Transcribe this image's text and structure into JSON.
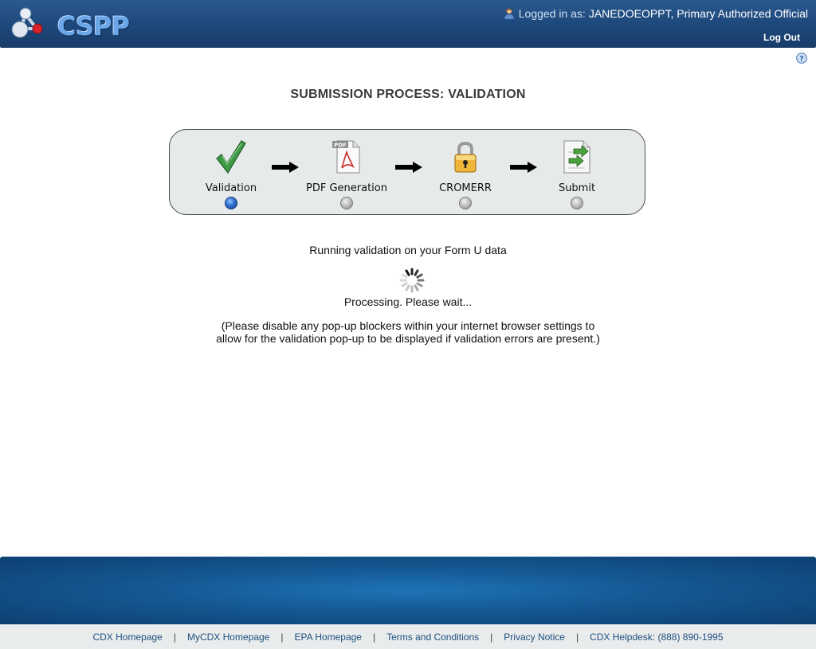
{
  "header": {
    "brand": "CSPP",
    "logged_in_prefix": "Logged in as:",
    "user": "JANEDOEOPPT, Primary Authorized Official",
    "logout": "Log Out"
  },
  "page": {
    "title": "SUBMISSION PROCESS: VALIDATION"
  },
  "process": {
    "steps": [
      {
        "label": "Validation",
        "icon": "checkmark-icon",
        "active": true
      },
      {
        "label": "PDF Generation",
        "icon": "pdf-document-icon",
        "active": false
      },
      {
        "label": "CROMERR",
        "icon": "padlock-icon",
        "active": false
      },
      {
        "label": "Submit",
        "icon": "submit-document-icon",
        "active": false
      }
    ]
  },
  "status": {
    "message": "Running validation on your Form U data",
    "processing": "Processing. Please wait...",
    "note_line1": "(Please disable any pop-up blockers within your internet browser settings to",
    "note_line2": "allow for the validation pop-up to be displayed if validation errors are present.)"
  },
  "footer": {
    "links": [
      "CDX Homepage",
      "MyCDX Homepage",
      "EPA Homepage",
      "Terms and Conditions",
      "Privacy Notice",
      "CDX Helpdesk: (888) 890-1995"
    ]
  },
  "colors": {
    "header": "#1f4a7e",
    "active_step": "#2f6ed1",
    "footer_band": "#145893",
    "link": "#1f4f7f"
  }
}
